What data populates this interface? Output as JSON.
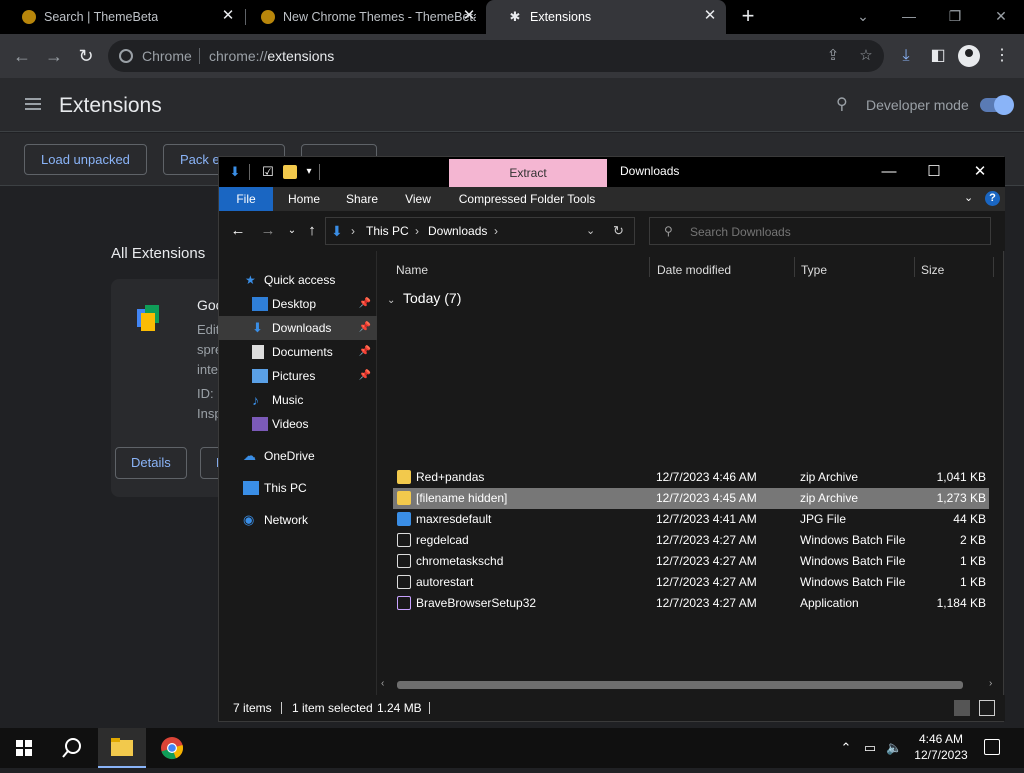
{
  "browser": {
    "tabs": [
      {
        "title": "Search | ThemeBeta",
        "active": false
      },
      {
        "title": "New Chrome Themes - ThemeBeta",
        "active": false
      },
      {
        "title": "Extensions",
        "active": true
      }
    ],
    "new_tab_label": "+",
    "omnibox": {
      "chip": "Chrome",
      "scheme": "chrome://",
      "host": "extensions"
    }
  },
  "extensions_page": {
    "title": "Extensions",
    "developer_mode_label": "Developer mode",
    "developer_mode_on": true,
    "buttons": {
      "load_unpacked": "Load unpacked",
      "pack": "Pack e",
      "update": "Update"
    },
    "section_title": "All Extensions",
    "card": {
      "name": "Goo",
      "desc_line1": "Edit",
      "desc_line2": "spre",
      "desc_line3": "inte",
      "id_label": "ID: ",
      "inspect_label": "Insp",
      "details_button": "Details",
      "remove_button": "R"
    }
  },
  "explorer": {
    "title": "Downloads",
    "contextual_tab": "Extract",
    "ribbon_tabs": [
      "File",
      "Home",
      "Share",
      "View",
      "Compressed Folder Tools"
    ],
    "breadcrumb": [
      "This PC",
      "Downloads"
    ],
    "search_placeholder": "Search Downloads",
    "nav": {
      "quick_access": "Quick access",
      "desktop": "Desktop",
      "downloads": "Downloads",
      "documents": "Documents",
      "pictures": "Pictures",
      "music": "Music",
      "videos": "Videos",
      "onedrive": "OneDrive",
      "this_pc": "This PC",
      "network": "Network"
    },
    "columns": {
      "name": "Name",
      "date": "Date modified",
      "type": "Type",
      "size": "Size"
    },
    "group": "Today (7)",
    "files": [
      {
        "name": "Red+pandas",
        "date": "12/7/2023 4:46 AM",
        "type": "zip Archive",
        "size": "1,041 KB",
        "selected": false
      },
      {
        "name": "[filename hidden]",
        "date": "12/7/2023 4:45 AM",
        "type": "zip Archive",
        "size": "1,273 KB",
        "selected": true
      },
      {
        "name": "maxresdefault",
        "date": "12/7/2023 4:41 AM",
        "type": "JPG File",
        "size": "44 KB",
        "selected": false
      },
      {
        "name": "regdelcad",
        "date": "12/7/2023 4:27 AM",
        "type": "Windows Batch File",
        "size": "2 KB",
        "selected": false
      },
      {
        "name": "chrometaskschd",
        "date": "12/7/2023 4:27 AM",
        "type": "Windows Batch File",
        "size": "1 KB",
        "selected": false
      },
      {
        "name": "autorestart",
        "date": "12/7/2023 4:27 AM",
        "type": "Windows Batch File",
        "size": "1 KB",
        "selected": false
      },
      {
        "name": "BraveBrowserSetup32",
        "date": "12/7/2023 4:27 AM",
        "type": "Application",
        "size": "1,184 KB",
        "selected": false
      }
    ],
    "status": {
      "count": "7 items",
      "selection": "1 item selected",
      "size": "1.24 MB"
    }
  },
  "taskbar": {
    "time": "4:46 AM",
    "date": "12/7/2023"
  },
  "colors": {
    "accent_blue": "#8ab4f8",
    "explorer_file_tab": "#1a66c2",
    "extract_tab": "#f4b6d2",
    "selected_row": "#777777"
  }
}
